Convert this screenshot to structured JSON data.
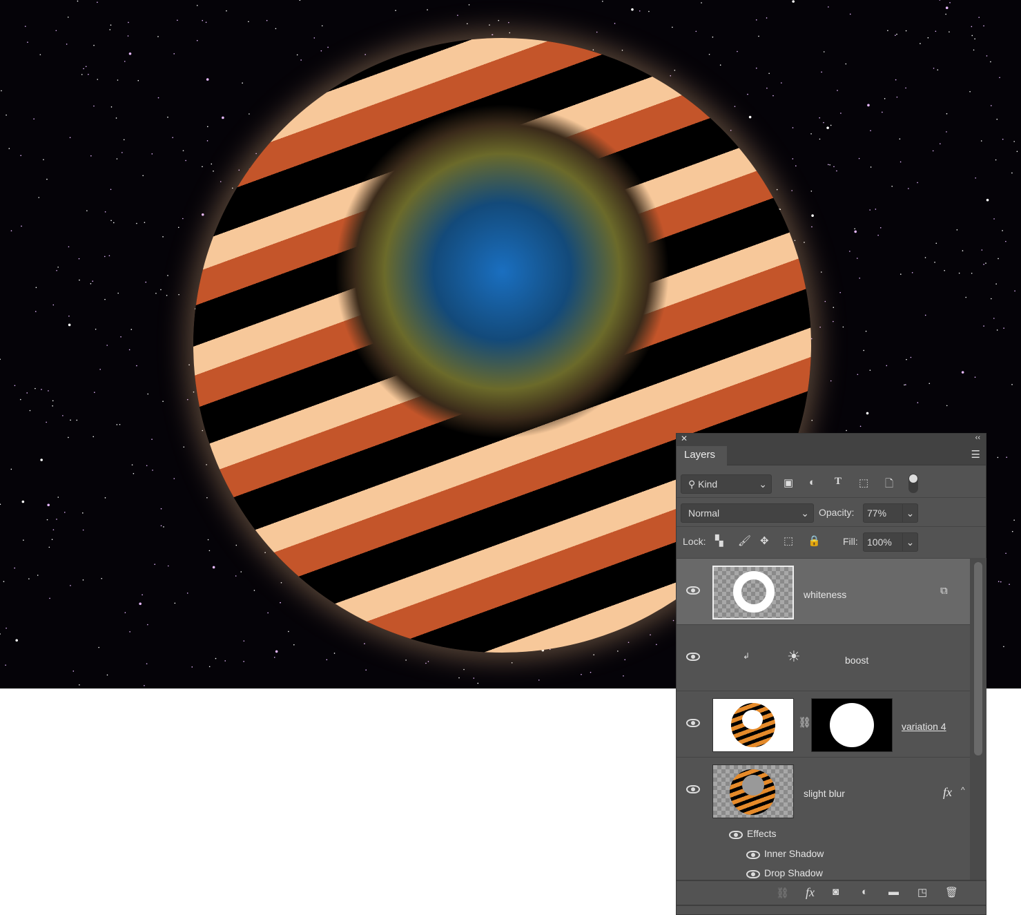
{
  "panel": {
    "tab": "Layers",
    "filter": {
      "kind_label": "Kind",
      "icons": [
        "pixel-filter-icon",
        "adjustment-filter-icon",
        "type-filter-icon",
        "shape-filter-icon",
        "smart-object-filter-icon",
        "filter-toggle-icon"
      ]
    },
    "blend_mode": "Normal",
    "opacity_label": "Opacity:",
    "opacity_value": "77%",
    "lock_label": "Lock:",
    "fill_label": "Fill:",
    "fill_value": "100%",
    "layers": [
      {
        "name": "whiteness",
        "selected": true
      },
      {
        "name": "boost",
        "type": "adjustment-brightness"
      },
      {
        "name": "variation 4",
        "has_mask": true
      },
      {
        "name": "slight blur",
        "has_fx": true
      }
    ],
    "effects": {
      "label": "Effects",
      "items": [
        "Inner Shadow",
        "Drop Shadow"
      ]
    },
    "fx_glyph": "fx"
  },
  "colors": {
    "panel": "#535353",
    "selected_row": "#696969"
  }
}
